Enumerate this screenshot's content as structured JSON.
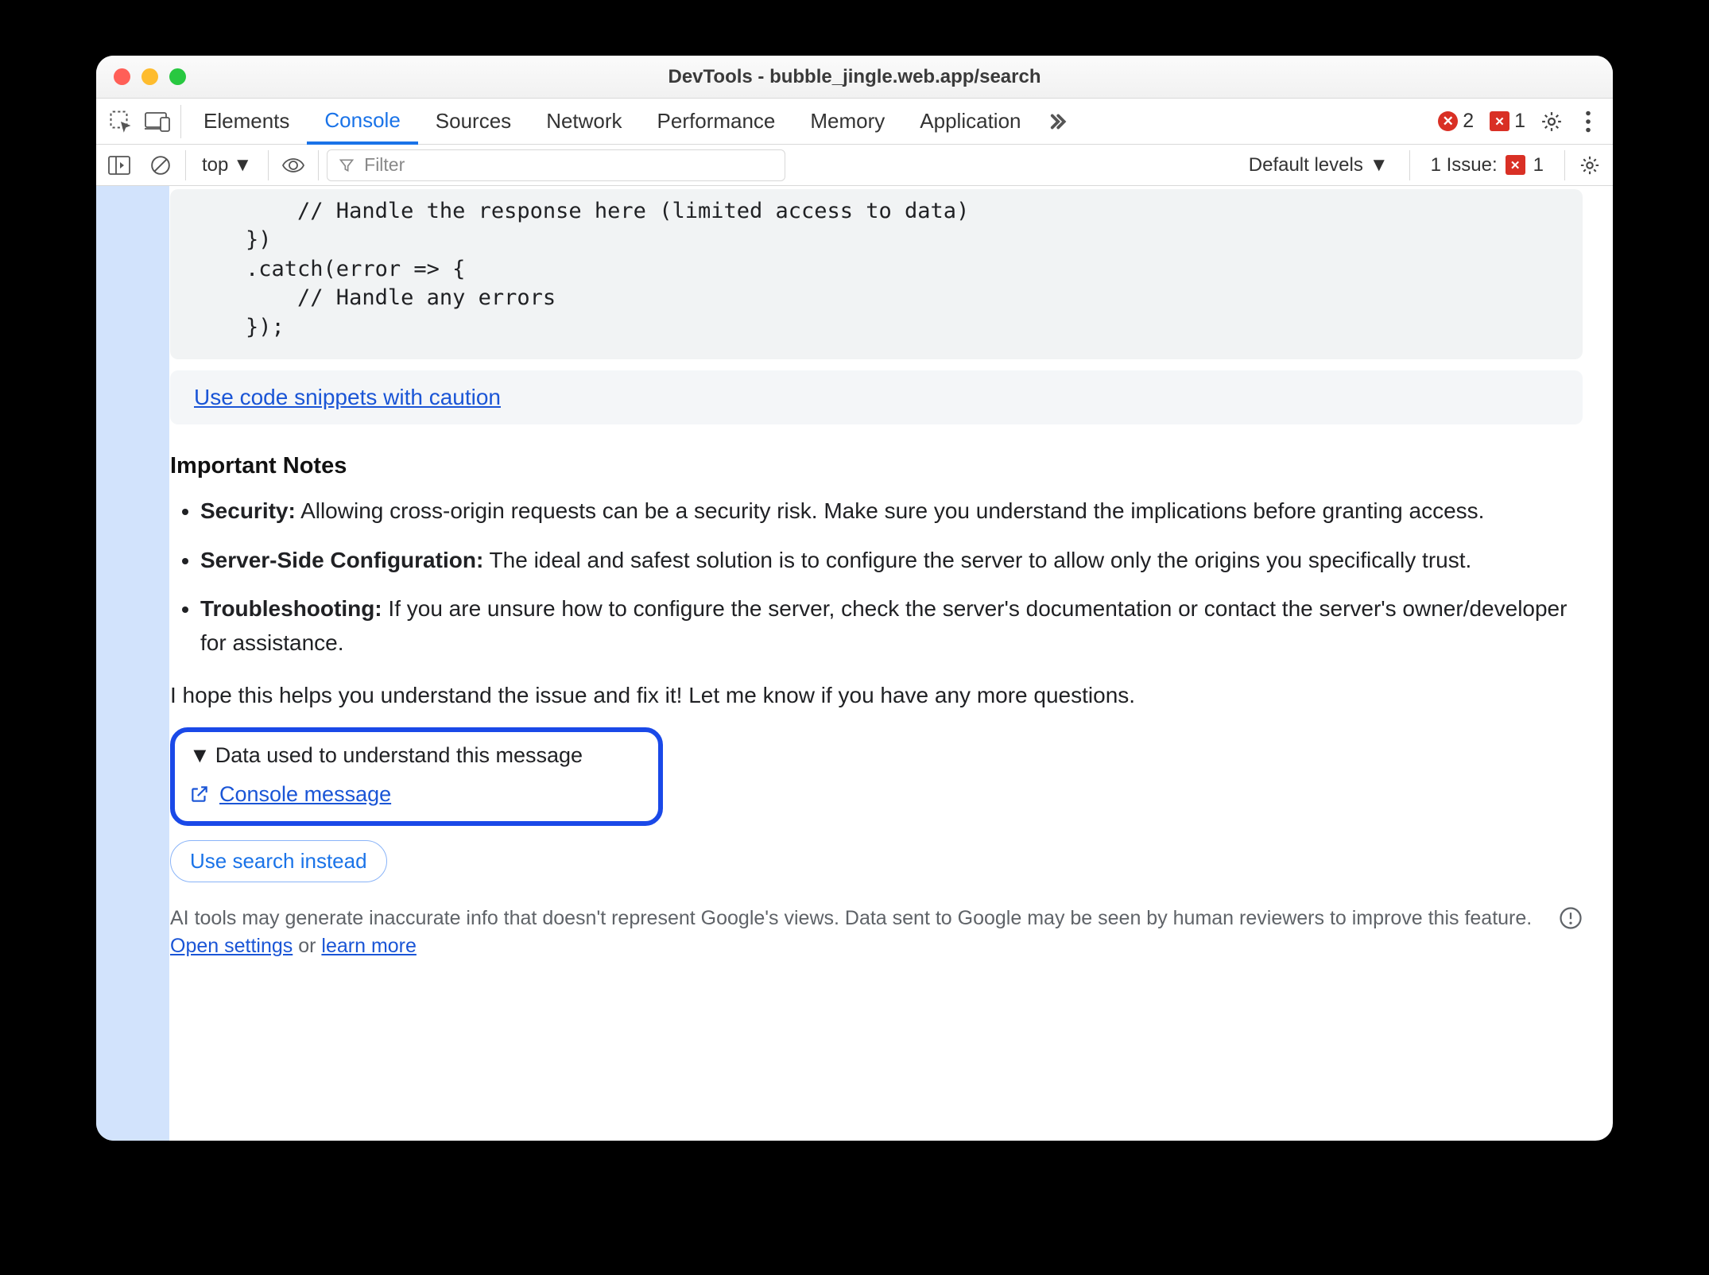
{
  "window": {
    "title": "DevTools - bubble_jingle.web.app/search"
  },
  "tabs": {
    "items": [
      "Elements",
      "Console",
      "Sources",
      "Network",
      "Performance",
      "Memory",
      "Application"
    ],
    "active": "Console",
    "errors_count": "2",
    "issues_count": "1"
  },
  "toolbar": {
    "context": "top",
    "filter_placeholder": "Filter",
    "levels": "Default levels",
    "issues_label": "1 Issue:",
    "issues_n": "1"
  },
  "code": "        // Handle the response here (limited access to data)\n    })\n    .catch(error => {\n        // Handle any errors\n    });",
  "caution_link": "Use code snippets with caution",
  "notes_heading": "Important Notes",
  "notes": [
    {
      "bold": "Security:",
      "text": " Allowing cross-origin requests can be a security risk. Make sure you understand the implications before granting access."
    },
    {
      "bold": "Server-Side Configuration:",
      "text": " The ideal and safest solution is to configure the server to allow only the origins you specifically trust."
    },
    {
      "bold": "Troubleshooting:",
      "text": " If you are unsure how to configure the server, check the server's documentation or contact the server's owner/developer for assistance."
    }
  ],
  "closing": "I hope this helps you understand the issue and fix it! Let me know if you have any more questions.",
  "disclosure": {
    "summary": "Data used to understand this message",
    "link": "Console message"
  },
  "pill": "Use search instead",
  "footer": {
    "part1": "AI tools may generate inaccurate info that doesn't represent Google's views. Data sent to Google may be seen by human reviewers to improve this feature. ",
    "settings": "Open settings",
    "or": " or ",
    "learn": "learn more"
  }
}
